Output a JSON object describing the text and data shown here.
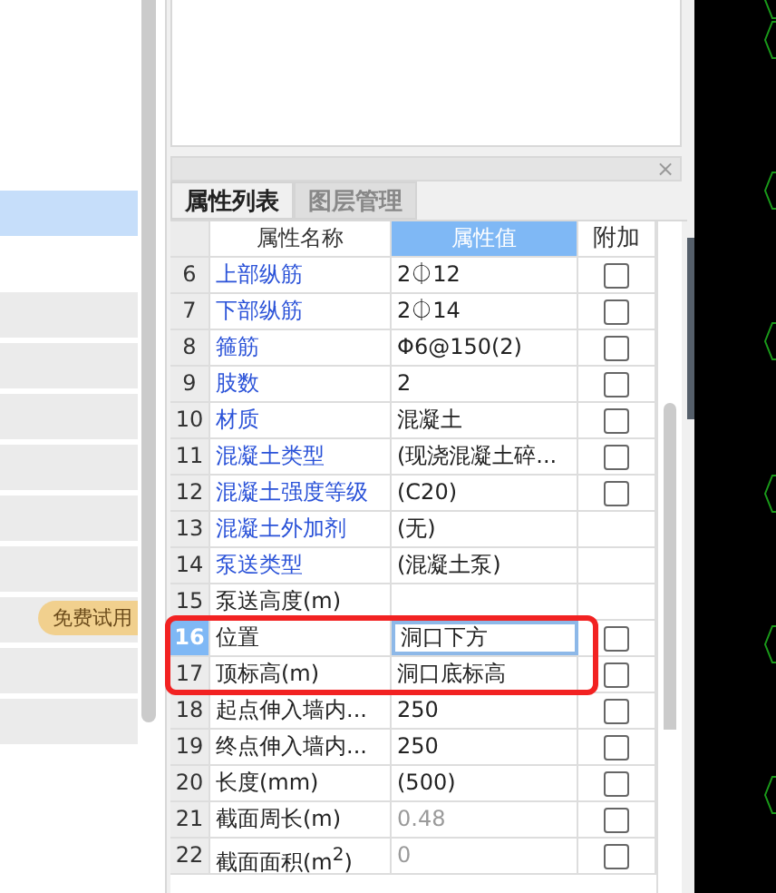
{
  "left_menu": {
    "items": [
      {
        "selected": true
      },
      {
        "selected": false
      },
      {
        "selected": false
      },
      {
        "selected": false
      },
      {
        "selected": false
      },
      {
        "selected": false
      },
      {
        "selected": false
      },
      {
        "selected": false,
        "badge": "免费试用"
      },
      {
        "selected": false
      },
      {
        "selected": false
      }
    ]
  },
  "panel": {
    "close": "×",
    "tabs": [
      {
        "label": "属性列表",
        "selected": true
      },
      {
        "label": "图层管理",
        "selected": false
      }
    ],
    "table": {
      "columns": [
        "属性名称",
        "属性值",
        "附加"
      ],
      "rows": [
        {
          "index": "6",
          "name": "上部纵筋",
          "value": "2⏀12",
          "linked": true,
          "muted": false,
          "selected": false,
          "checked": false
        },
        {
          "index": "7",
          "name": "下部纵筋",
          "value": "2⏀14",
          "linked": true,
          "muted": false,
          "selected": false,
          "checked": false
        },
        {
          "index": "8",
          "name": "箍筋",
          "value": "Φ6@150(2)",
          "linked": true,
          "muted": false,
          "selected": false,
          "checked": false
        },
        {
          "index": "9",
          "name": "肢数",
          "value": "2",
          "linked": true,
          "muted": false,
          "selected": false,
          "checked": false
        },
        {
          "index": "10",
          "name": "材质",
          "value": "混凝土",
          "linked": true,
          "muted": false,
          "selected": false,
          "checked": false
        },
        {
          "index": "11",
          "name": "混凝土类型",
          "value": "(现浇混凝土碎...",
          "linked": true,
          "muted": false,
          "selected": false,
          "checked": false
        },
        {
          "index": "12",
          "name": "混凝土强度等级",
          "value": "(C20)",
          "linked": true,
          "muted": false,
          "selected": false,
          "checked": false
        },
        {
          "index": "13",
          "name": "混凝土外加剂",
          "value": "(无)",
          "linked": true,
          "muted": false,
          "selected": false
        },
        {
          "index": "14",
          "name": "泵送类型",
          "value": "(混凝土泵)",
          "linked": true,
          "muted": false,
          "selected": false
        },
        {
          "index": "15",
          "name": "泵送高度(m)",
          "linked": false,
          "selected": false
        },
        {
          "index": "16",
          "name": "位置",
          "value": "洞口下方",
          "linked": false,
          "muted": false,
          "selected": true,
          "checked": false
        },
        {
          "index": "17",
          "name": "顶标高(m)",
          "value": "洞口底标高",
          "linked": false,
          "muted": false,
          "selected": false,
          "checked": false
        },
        {
          "index": "18",
          "name": "起点伸入墙内...",
          "value": "250",
          "linked": false,
          "muted": false,
          "selected": false,
          "checked": false
        },
        {
          "index": "19",
          "name": "终点伸入墙内...",
          "value": "250",
          "linked": false,
          "muted": false,
          "selected": false,
          "checked": false
        },
        {
          "index": "20",
          "name": "长度(mm)",
          "value": "(500)",
          "linked": false,
          "muted": false,
          "selected": false,
          "checked": false
        },
        {
          "index": "21",
          "name": "截面周长(m)",
          "value": "0.48",
          "linked": false,
          "muted": true,
          "selected": false,
          "checked": false
        },
        {
          "index": "22",
          "name": "截面面积(m$^{2}$)",
          "value": "0",
          "linked": false,
          "muted": true,
          "selected": false,
          "checked": false
        }
      ]
    }
  }
}
